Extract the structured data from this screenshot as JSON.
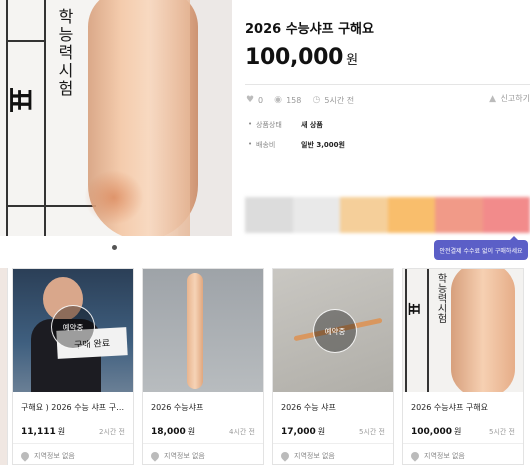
{
  "product": {
    "title": "2026 수능샤프 구해요",
    "price": "100,000",
    "price_unit": "원",
    "likes": "0",
    "views": "158",
    "time": "5시간 전",
    "report_label": "신고하기",
    "condition_key": "상품상태",
    "condition_value": "새 상품",
    "shipping_key": "배송비",
    "shipping_value": "일반 3,000원",
    "tooltip": "안전결제 수수료 없이 구매하세요",
    "photo_text": "학능력시험",
    "photo_char": "표"
  },
  "listings": [
    {
      "title": "구해요 ) 2026 수능 샤프 구…",
      "price": "11,111",
      "unit": "원",
      "time": "2시간 전",
      "location": "지역정보 없음",
      "badge": "예약중",
      "overlay": "구매 완료"
    },
    {
      "title": "2026 수능샤프",
      "price": "18,000",
      "unit": "원",
      "time": "4시간 전",
      "location": "지역정보 없음"
    },
    {
      "title": "2026 수능 샤프",
      "price": "17,000",
      "unit": "원",
      "time": "5시간 전",
      "location": "지역정보 없음",
      "badge": "예약중"
    },
    {
      "title": "2026 수능샤프 구해요",
      "price": "100,000",
      "unit": "원",
      "time": "5시간 전",
      "location": "지역정보 없음",
      "photo_text": "학능력시험"
    }
  ],
  "colors": {
    "accent": "#5b5fc7"
  },
  "icons": [
    "heart-icon",
    "eye-icon",
    "clock-icon",
    "siren-icon",
    "location-pin-icon"
  ]
}
